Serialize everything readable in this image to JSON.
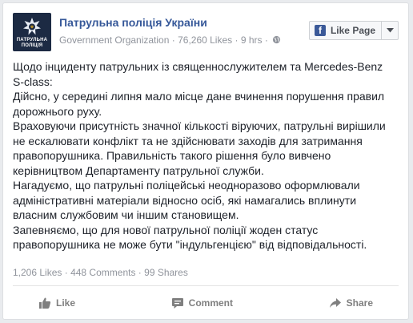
{
  "page": {
    "name": "Патрульна поліція України",
    "category": "Government Organization",
    "likes": "76,260 Likes",
    "time": "9 hrs",
    "separator": "·",
    "logo_text_line1": "ПАТРУЛЬНА",
    "logo_text_line2": "ПОЛІЦІЯ"
  },
  "like_page_button": {
    "label": "Like Page"
  },
  "post": {
    "paragraphs": [
      "Щодо інциденту патрульних із священнослужителем та Mercedes-Benz S-class:",
      "Дійсно, у середині липня мало місце дане вчинення порушення правил дорожнього руху.",
      "Враховуючи присутність значної кількості віруючих, патрульні вирішили не ескалювати конфлікт та не здійснювати заходів для затримання правопорушника. Правильність такого рішення було вивчено керівництвом Департаменту патрульної служби.",
      "Нагадуємо, що патрульні поліцейські неодноразово оформлювали адміністративні матеріали відносно осіб, які намагались вплинути власним службовим чи іншим становищем.",
      "Запевняємо, що для нової патрульної поліції жоден статус правопорушника не може бути \"індульгенцією\" від відповідальності."
    ]
  },
  "stats": {
    "likes": "1,206 Likes",
    "comments": "448 Comments",
    "shares": "99 Shares",
    "separator": "·"
  },
  "actions": {
    "like": "Like",
    "comment": "Comment",
    "share": "Share"
  },
  "colors": {
    "link": "#365899",
    "facebook_blue": "#3b5998",
    "muted": "#90949c"
  }
}
